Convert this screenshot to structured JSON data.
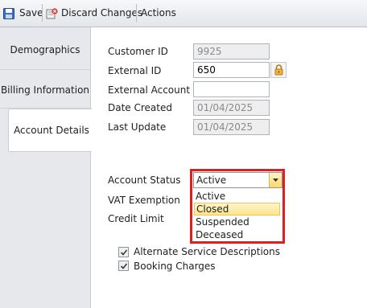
{
  "toolbar": {
    "save_label": "Save",
    "discard_label": "Discard Changes",
    "actions_label": "Actions"
  },
  "tabs": {
    "demographics": "Demographics",
    "billing": "Billing Information",
    "account_details": "Account Details"
  },
  "form": {
    "customer_id_label": "Customer ID",
    "customer_id_value": "9925",
    "external_id_label": "External ID",
    "external_id_value": "650",
    "external_account_label": "External Account No",
    "external_account_value": "",
    "date_created_label": "Date Created",
    "date_created_value": "01/04/2025",
    "last_update_label": "Last Update",
    "last_update_value": "01/04/2025",
    "account_status_label": "Account Status",
    "account_status_value": "Active",
    "vat_label": "VAT Exemption",
    "credit_label": "Credit Limit",
    "status_options": [
      "Active",
      "Closed",
      "Suspended",
      "Deceased"
    ],
    "alt_service_label": "Alternate Service Descriptions",
    "booking_label": "Booking Charges"
  },
  "colors": {
    "highlight": "#e01e1e",
    "hover_option": "#ffe48d",
    "tab_background": "#e6e8eb"
  },
  "icons": [
    "save-icon",
    "discard-icon",
    "lock-icon",
    "dropdown-arrow-icon",
    "checkmark-icon"
  ]
}
